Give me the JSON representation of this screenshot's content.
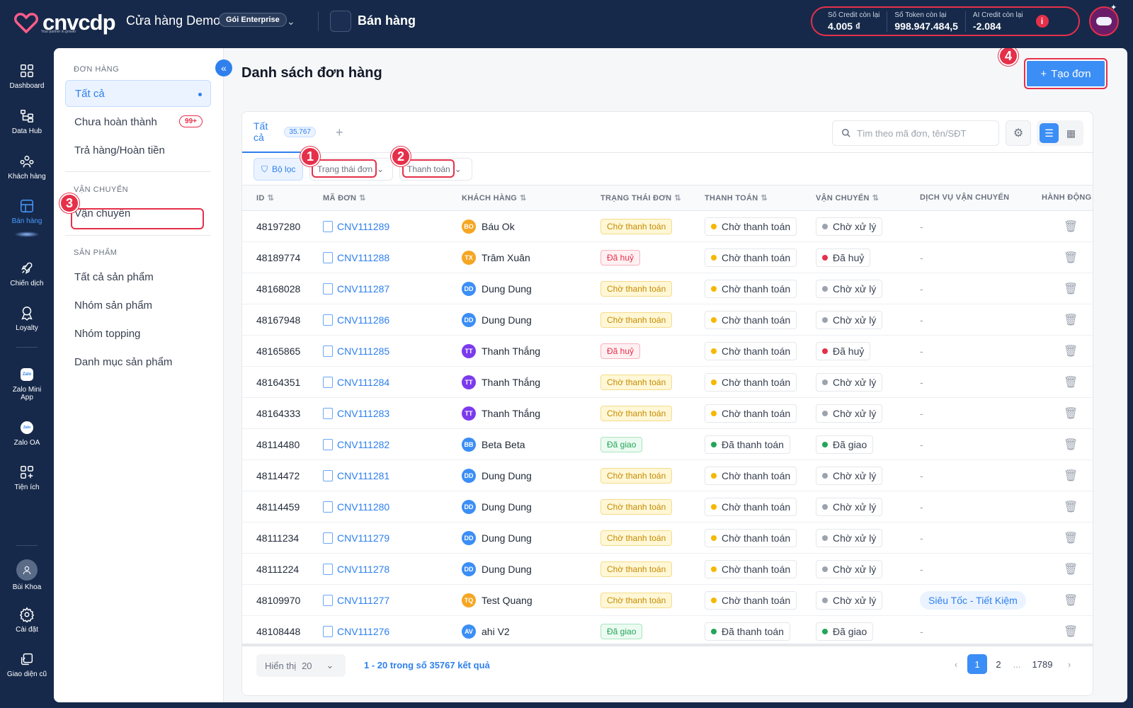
{
  "top": {
    "logo": "cnvcdp",
    "logo_tagline": "Your partner in growth",
    "store": "Cửa hàng Demo",
    "plan": "Gói Enterprise",
    "app_title": "Bán hàng",
    "credits": [
      {
        "label": "Số Credit còn lại",
        "value": "4.005 ₫"
      },
      {
        "label": "Số Token còn lại",
        "value": "998.947.484,5"
      },
      {
        "label": "AI Credit còn lại",
        "value": "-2.084"
      }
    ]
  },
  "nav": [
    {
      "label": "Dashboard",
      "icon": "dashboard-icon"
    },
    {
      "label": "Data Hub",
      "icon": "data-hub-icon"
    },
    {
      "label": "Khách hàng",
      "icon": "customers-icon"
    },
    {
      "label": "Bán hàng",
      "icon": "sales-icon",
      "active": true
    },
    {
      "label": "Chiến dịch",
      "icon": "rocket-icon"
    },
    {
      "label": "Loyalty",
      "icon": "loyalty-icon"
    },
    {
      "label": "Zalo Mini App",
      "icon": "zalo-icon"
    },
    {
      "label": "Zalo OA",
      "icon": "zalo-oa-icon"
    },
    {
      "label": "Tiện ích",
      "icon": "extensions-icon"
    },
    {
      "label": "Bùi Khoa",
      "icon": "user-avatar-icon"
    },
    {
      "label": "Cài đặt",
      "icon": "settings-icon"
    },
    {
      "label": "Giao diện cũ",
      "icon": "old-ui-icon"
    }
  ],
  "sub": {
    "sec1": "ĐƠN HÀNG",
    "all": "Tất cả",
    "incomplete": "Chưa hoàn thành",
    "incomplete_badge": "99+",
    "refund": "Trả hàng/Hoàn tiền",
    "sec2": "VẬN CHUYỂN",
    "shipping": "Vận chuyển",
    "sec3": "SẢN PHẨM",
    "products_all": "Tất cả sản phẩm",
    "product_groups": "Nhóm sản phẩm",
    "topping_groups": "Nhóm topping",
    "catalog": "Danh mục sản phẩm"
  },
  "annotations": [
    "1",
    "2",
    "3",
    "4"
  ],
  "page": {
    "title": "Danh sách đơn hàng",
    "create_label": "Tạo đơn",
    "tab_all": "Tất cả",
    "tab_count": "35.767",
    "search_placeholder": "Tìm theo mã đơn, tên/SĐT",
    "filter_label": "Bộ lọc",
    "filter_status": "Trạng thái đơn",
    "filter_payment": "Thanh toán"
  },
  "columns": [
    "ID",
    "MÃ ĐƠN",
    "KHÁCH HÀNG",
    "TRẠNG THÁI ĐƠN",
    "THANH TOÁN",
    "VẬN CHUYỂN",
    "DỊCH VỤ VẬN CHUYỂN",
    "HÀNH ĐỘNG"
  ],
  "colors": {
    "yellow": "#f5b800",
    "red": "#e5304a",
    "green": "#22a559",
    "gray": "#9ca3af"
  },
  "orders": [
    {
      "id": "48197280",
      "code": "CNV111289",
      "initials": "BO",
      "av": "#f5a623",
      "name": "Báu Ok",
      "status": "Chờ thanh toán",
      "sc": "y",
      "pay": "Chờ thanh toán",
      "pc": "#f5b800",
      "ship": "Chờ xử lý",
      "shc": "#9ca3af",
      "svc": "-"
    },
    {
      "id": "48189774",
      "code": "CNV111288",
      "initials": "TX",
      "av": "#f5a623",
      "name": "Trâm Xuân",
      "status": "Đã huỷ",
      "sc": "r",
      "pay": "Chờ thanh toán",
      "pc": "#f5b800",
      "ship": "Đã huỷ",
      "shc": "#e5304a",
      "svc": "-"
    },
    {
      "id": "48168028",
      "code": "CNV111287",
      "initials": "DD",
      "av": "#3b8ef5",
      "name": "Dung Dung",
      "status": "Chờ thanh toán",
      "sc": "y",
      "pay": "Chờ thanh toán",
      "pc": "#f5b800",
      "ship": "Chờ xử lý",
      "shc": "#9ca3af",
      "svc": "-"
    },
    {
      "id": "48167948",
      "code": "CNV111286",
      "initials": "DD",
      "av": "#3b8ef5",
      "name": "Dung Dung",
      "status": "Chờ thanh toán",
      "sc": "y",
      "pay": "Chờ thanh toán",
      "pc": "#f5b800",
      "ship": "Chờ xử lý",
      "shc": "#9ca3af",
      "svc": "-"
    },
    {
      "id": "48165865",
      "code": "CNV111285",
      "initials": "TT",
      "av": "#7c3aed",
      "name": "Thanh Thắng",
      "status": "Đã huỷ",
      "sc": "r",
      "pay": "Chờ thanh toán",
      "pc": "#f5b800",
      "ship": "Đã huỷ",
      "shc": "#e5304a",
      "svc": "-"
    },
    {
      "id": "48164351",
      "code": "CNV111284",
      "initials": "TT",
      "av": "#7c3aed",
      "name": "Thanh Thắng",
      "status": "Chờ thanh toán",
      "sc": "y",
      "pay": "Chờ thanh toán",
      "pc": "#f5b800",
      "ship": "Chờ xử lý",
      "shc": "#9ca3af",
      "svc": "-"
    },
    {
      "id": "48164333",
      "code": "CNV111283",
      "initials": "TT",
      "av": "#7c3aed",
      "name": "Thanh Thắng",
      "status": "Chờ thanh toán",
      "sc": "y",
      "pay": "Chờ thanh toán",
      "pc": "#f5b800",
      "ship": "Chờ xử lý",
      "shc": "#9ca3af",
      "svc": "-"
    },
    {
      "id": "48114480",
      "code": "CNV111282",
      "initials": "BB",
      "av": "#3b8ef5",
      "name": "Beta Beta",
      "status": "Đã giao",
      "sc": "g",
      "pay": "Đã thanh toán",
      "pc": "#22a559",
      "ship": "Đã giao",
      "shc": "#22a559",
      "svc": "-"
    },
    {
      "id": "48114472",
      "code": "CNV111281",
      "initials": "DD",
      "av": "#3b8ef5",
      "name": "Dung Dung",
      "status": "Chờ thanh toán",
      "sc": "y",
      "pay": "Chờ thanh toán",
      "pc": "#f5b800",
      "ship": "Chờ xử lý",
      "shc": "#9ca3af",
      "svc": "-"
    },
    {
      "id": "48114459",
      "code": "CNV111280",
      "initials": "DD",
      "av": "#3b8ef5",
      "name": "Dung Dung",
      "status": "Chờ thanh toán",
      "sc": "y",
      "pay": "Chờ thanh toán",
      "pc": "#f5b800",
      "ship": "Chờ xử lý",
      "shc": "#9ca3af",
      "svc": "-"
    },
    {
      "id": "48111234",
      "code": "CNV111279",
      "initials": "DD",
      "av": "#3b8ef5",
      "name": "Dung Dung",
      "status": "Chờ thanh toán",
      "sc": "y",
      "pay": "Chờ thanh toán",
      "pc": "#f5b800",
      "ship": "Chờ xử lý",
      "shc": "#9ca3af",
      "svc": "-"
    },
    {
      "id": "48111224",
      "code": "CNV111278",
      "initials": "DD",
      "av": "#3b8ef5",
      "name": "Dung Dung",
      "status": "Chờ thanh toán",
      "sc": "y",
      "pay": "Chờ thanh toán",
      "pc": "#f5b800",
      "ship": "Chờ xử lý",
      "shc": "#9ca3af",
      "svc": "-"
    },
    {
      "id": "48109970",
      "code": "CNV111277",
      "initials": "TQ",
      "av": "#f5a623",
      "name": "Test Quang",
      "status": "Chờ thanh toán",
      "sc": "y",
      "pay": "Chờ thanh toán",
      "pc": "#f5b800",
      "ship": "Chờ xử lý",
      "shc": "#9ca3af",
      "svc": "Siêu Tốc - Tiết Kiệm"
    },
    {
      "id": "48108448",
      "code": "CNV111276",
      "initials": "AV",
      "av": "#3b8ef5",
      "name": "ahi V2",
      "status": "Đã giao",
      "sc": "g",
      "pay": "Đã thanh toán",
      "pc": "#22a559",
      "ship": "Đã giao",
      "shc": "#22a559",
      "svc": "-"
    }
  ],
  "footer": {
    "show_label": "Hiển thị",
    "per_page": "20",
    "range": "1 - 20 trong số 35767 kết quả",
    "pages": [
      "1",
      "2",
      "...",
      "1789"
    ]
  }
}
